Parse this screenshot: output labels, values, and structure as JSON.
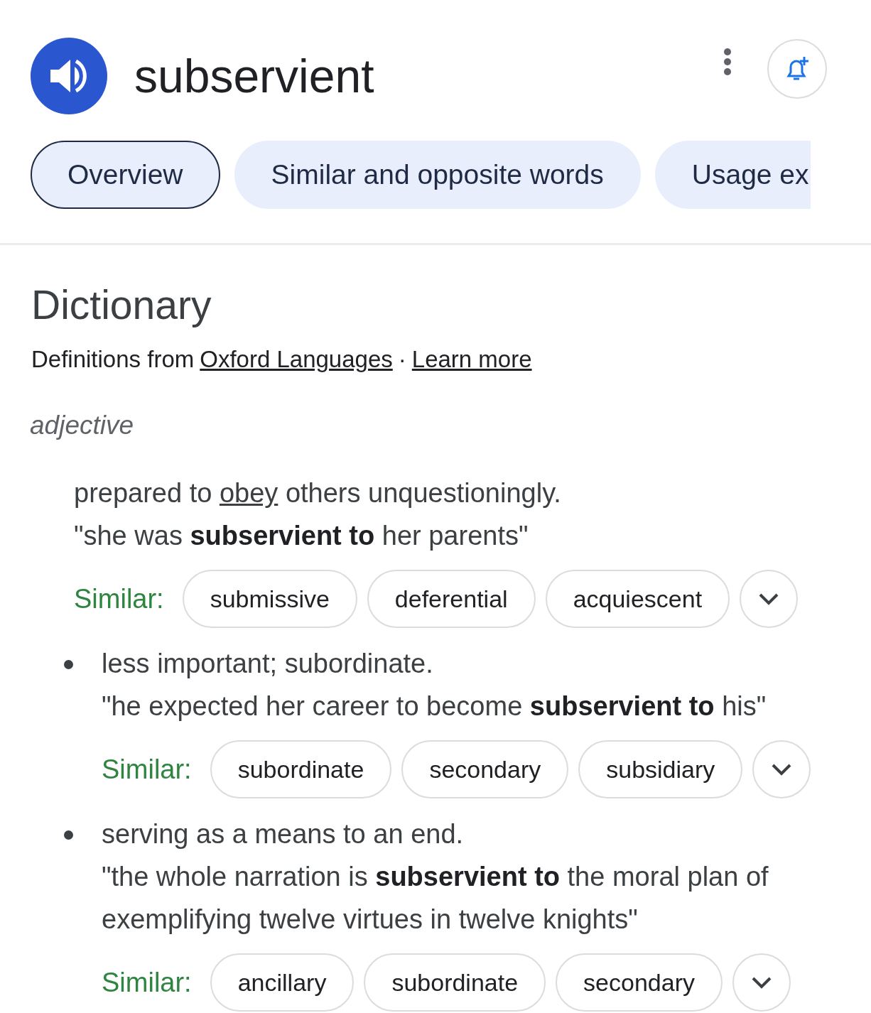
{
  "header": {
    "word": "subservient"
  },
  "tabs": [
    {
      "label": "Overview",
      "selected": true
    },
    {
      "label": "Similar and opposite words",
      "selected": false
    },
    {
      "label": "Usage ex",
      "selected": false
    }
  ],
  "dictionary": {
    "title": "Dictionary",
    "source_prefix": "Definitions from",
    "source_link": "Oxford Languages",
    "separator": "·",
    "learn_more": "Learn more",
    "part_of_speech": "adjective",
    "senses": [
      {
        "kind": "main",
        "definition": [
          {
            "kind": "text",
            "text": "prepared to "
          },
          {
            "kind": "link",
            "text": "obey"
          },
          {
            "kind": "text",
            "text": " others unquestioningly."
          }
        ],
        "example": "\"she was **subservient to** her parents\"",
        "similar_label": "Similar:",
        "similar": [
          "submissive",
          "deferential",
          "acquiescent"
        ]
      },
      {
        "kind": "sub",
        "definition": [
          {
            "kind": "text",
            "text": "less important; subordinate."
          }
        ],
        "example": "\"he expected her career to become **subservient to** his\"",
        "similar_label": "Similar:",
        "similar": [
          "subordinate",
          "secondary",
          "subsidiary"
        ]
      },
      {
        "kind": "sub",
        "definition": [
          {
            "kind": "text",
            "text": "serving as a means to an end."
          }
        ],
        "example": "\"the whole narration is **subservient to** the moral plan of exemplifying twelve virtues in twelve knights\"",
        "similar_label": "Similar:",
        "similar": [
          "ancillary",
          "subordinate",
          "secondary"
        ]
      }
    ]
  }
}
